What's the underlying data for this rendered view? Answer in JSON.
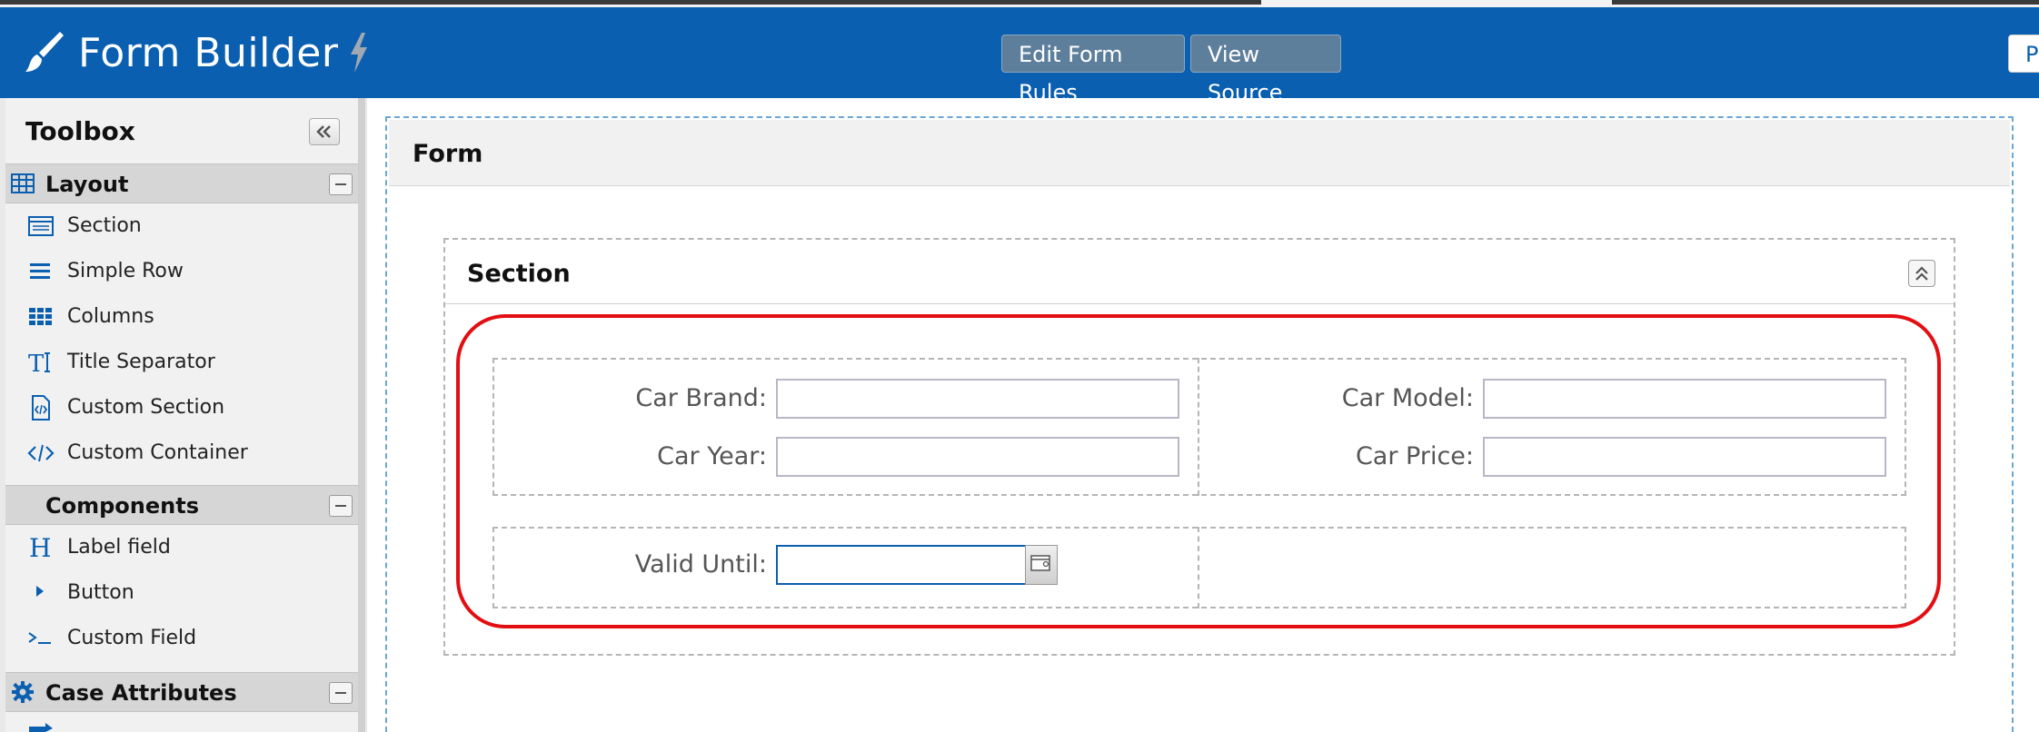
{
  "header": {
    "app_title": "Form Builder",
    "edit_rules_label": "Edit Form Rules",
    "view_source_label": "View Source",
    "partial_button_label": "P"
  },
  "sidebar": {
    "title": "Toolbox",
    "groups": [
      {
        "label": "Layout",
        "icon": "table-grid-icon",
        "items": [
          {
            "label": "Section",
            "icon": "section-list-icon"
          },
          {
            "label": "Simple Row",
            "icon": "hamburger-rows-icon"
          },
          {
            "label": "Columns",
            "icon": "columns-grid-icon"
          },
          {
            "label": "Title Separator",
            "icon": "title-text-icon"
          },
          {
            "label": "Custom Section",
            "icon": "code-file-icon"
          },
          {
            "label": "Custom Container",
            "icon": "code-brackets-icon"
          }
        ]
      },
      {
        "label": "Components",
        "icon": "",
        "items": [
          {
            "label": "Label field",
            "icon": "heading-h-icon"
          },
          {
            "label": "Button",
            "icon": "caret-right-icon"
          },
          {
            "label": "Custom Field",
            "icon": "terminal-prompt-icon"
          }
        ]
      },
      {
        "label": "Case Attributes",
        "icon": "gear-icon",
        "items": []
      }
    ]
  },
  "form": {
    "title": "Form",
    "section": {
      "title": "Section",
      "fields": {
        "car_brand": {
          "label": "Car Brand:",
          "value": ""
        },
        "car_model": {
          "label": "Car Model:",
          "value": ""
        },
        "car_year": {
          "label": "Car Year:",
          "value": ""
        },
        "car_price": {
          "label": "Car Price:",
          "value": ""
        },
        "valid_until": {
          "label": "Valid Until:",
          "value": ""
        }
      }
    }
  },
  "colors": {
    "header_bg": "#0a5fb0",
    "highlight": "#e30e12",
    "button_bg": "#5e7f9c"
  }
}
